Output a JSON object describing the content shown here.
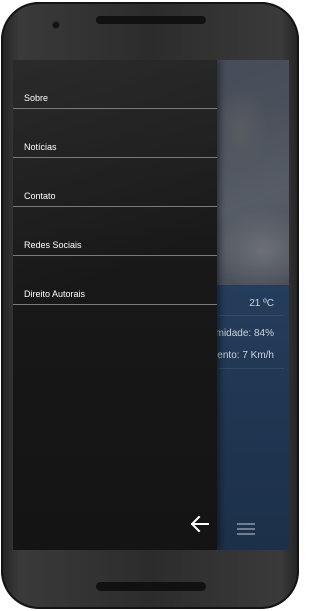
{
  "drawer": {
    "items": [
      {
        "label": "Sobre"
      },
      {
        "label": "Notícias"
      },
      {
        "label": "Contato"
      },
      {
        "label": "Redes Sociais"
      },
      {
        "label": "Direito Autorais"
      }
    ],
    "back_icon": "arrow-left-icon"
  },
  "weather": {
    "temperature": "21 ºC",
    "humidity": "midade: 84%",
    "wind": "ento: 7 Km/h"
  },
  "toolbar": {
    "menu_icon": "hamburger-menu-icon"
  },
  "colors": {
    "drawer_bg": "#181818",
    "app_bg": "#1f3550",
    "divider": "#7a7a7a",
    "text": "#ffffff"
  }
}
